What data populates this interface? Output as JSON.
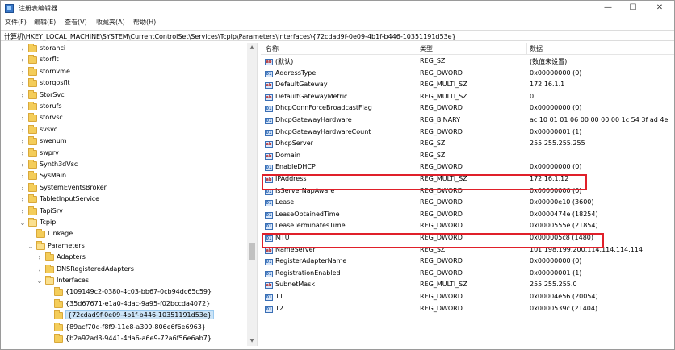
{
  "window": {
    "title": "注册表编辑器"
  },
  "titlebar": {
    "minimize": "—",
    "maximize": "☐",
    "close": "✕"
  },
  "menu": [
    "文件(F)",
    "编辑(E)",
    "查看(V)",
    "收藏夹(A)",
    "帮助(H)"
  ],
  "address": "计算机\\HKEY_LOCAL_MACHINE\\SYSTEM\\CurrentControlSet\\Services\\Tcpip\\Parameters\\Interfaces\\{72cdad9f-0e09-4b1f-b446-10351191d53e}",
  "tree": [
    {
      "label": "storahci",
      "level": 0,
      "expanded": false
    },
    {
      "label": "storflt",
      "level": 0,
      "expanded": false
    },
    {
      "label": "stornvme",
      "level": 0,
      "expanded": false
    },
    {
      "label": "storqosflt",
      "level": 0,
      "expanded": false
    },
    {
      "label": "StorSvc",
      "level": 0,
      "expanded": false
    },
    {
      "label": "storufs",
      "level": 0,
      "expanded": false
    },
    {
      "label": "storvsc",
      "level": 0,
      "expanded": false
    },
    {
      "label": "svsvc",
      "level": 0,
      "expanded": false
    },
    {
      "label": "swenum",
      "level": 0,
      "expanded": false
    },
    {
      "label": "swprv",
      "level": 0,
      "expanded": false
    },
    {
      "label": "Synth3dVsc",
      "level": 0,
      "expanded": false
    },
    {
      "label": "SysMain",
      "level": 0,
      "expanded": false
    },
    {
      "label": "SystemEventsBroker",
      "level": 0,
      "expanded": false
    },
    {
      "label": "TabletInputService",
      "level": 0,
      "expanded": false
    },
    {
      "label": "TapiSrv",
      "level": 0,
      "expanded": false
    },
    {
      "label": "Tcpip",
      "level": 0,
      "expanded": true
    },
    {
      "label": "Linkage",
      "level": 1,
      "expanded": null
    },
    {
      "label": "Parameters",
      "level": 1,
      "expanded": true
    },
    {
      "label": "Adapters",
      "level": 2,
      "expanded": false
    },
    {
      "label": "DNSRegisteredAdapters",
      "level": 2,
      "expanded": false
    },
    {
      "label": "Interfaces",
      "level": 2,
      "expanded": true
    },
    {
      "label": "{109149c2-0380-4c03-bb67-0cb94dc65c59}",
      "level": 3,
      "expanded": null
    },
    {
      "label": "{35d67671-e1a0-4dac-9a95-f02bccda4072}",
      "level": 3,
      "expanded": null
    },
    {
      "label": "{72cdad9f-0e09-4b1f-b446-10351191d53e}",
      "level": 3,
      "expanded": null,
      "selected": true
    },
    {
      "label": "{89acf70d-f8f9-11e8-a309-806e6f6e6963}",
      "level": 3,
      "expanded": null
    },
    {
      "label": "{b2a92ad3-9441-4da6-a6e9-72a6f56e6ab7}",
      "level": 3,
      "expanded": null
    }
  ],
  "columns": {
    "name": "名称",
    "type": "类型",
    "data": "数据"
  },
  "values": [
    {
      "name": "(默认)",
      "type": "REG_SZ",
      "data": "(数值未设置)",
      "icon": "ab"
    },
    {
      "name": "AddressType",
      "type": "REG_DWORD",
      "data": "0x00000000 (0)",
      "icon": "bin"
    },
    {
      "name": "DefaultGateway",
      "type": "REG_MULTI_SZ",
      "data": "172.16.1.1",
      "icon": "ab"
    },
    {
      "name": "DefaultGatewayMetric",
      "type": "REG_MULTI_SZ",
      "data": "0",
      "icon": "ab"
    },
    {
      "name": "DhcpConnForceBroadcastFlag",
      "type": "REG_DWORD",
      "data": "0x00000000 (0)",
      "icon": "bin"
    },
    {
      "name": "DhcpGatewayHardware",
      "type": "REG_BINARY",
      "data": "ac 10 01 01 06 00 00 00 00 1c 54 3f ad 4e",
      "icon": "bin"
    },
    {
      "name": "DhcpGatewayHardwareCount",
      "type": "REG_DWORD",
      "data": "0x00000001 (1)",
      "icon": "bin"
    },
    {
      "name": "DhcpServer",
      "type": "REG_SZ",
      "data": "255.255.255.255",
      "icon": "ab"
    },
    {
      "name": "Domain",
      "type": "REG_SZ",
      "data": "",
      "icon": "ab"
    },
    {
      "name": "EnableDHCP",
      "type": "REG_DWORD",
      "data": "0x00000000 (0)",
      "icon": "bin"
    },
    {
      "name": "IPAddress",
      "type": "REG_MULTI_SZ",
      "data": "172.16.1.12",
      "icon": "ab"
    },
    {
      "name": "IsServerNapAware",
      "type": "REG_DWORD",
      "data": "0x00000000 (0)",
      "icon": "bin"
    },
    {
      "name": "Lease",
      "type": "REG_DWORD",
      "data": "0x00000e10 (3600)",
      "icon": "bin"
    },
    {
      "name": "LeaseObtainedTime",
      "type": "REG_DWORD",
      "data": "0x0000474e (18254)",
      "icon": "bin"
    },
    {
      "name": "LeaseTerminatesTime",
      "type": "REG_DWORD",
      "data": "0x0000555e (21854)",
      "icon": "bin"
    },
    {
      "name": "MTU",
      "type": "REG_DWORD",
      "data": "0x000005c8 (1480)",
      "icon": "bin"
    },
    {
      "name": "NameServer",
      "type": "REG_SZ",
      "data": "101.198.199.200,114.114.114.114",
      "icon": "ab"
    },
    {
      "name": "RegisterAdapterName",
      "type": "REG_DWORD",
      "data": "0x00000000 (0)",
      "icon": "bin"
    },
    {
      "name": "RegistrationEnabled",
      "type": "REG_DWORD",
      "data": "0x00000001 (1)",
      "icon": "bin"
    },
    {
      "name": "SubnetMask",
      "type": "REG_MULTI_SZ",
      "data": "255.255.255.0",
      "icon": "ab"
    },
    {
      "name": "T1",
      "type": "REG_DWORD",
      "data": "0x00004e56 (20054)",
      "icon": "bin"
    },
    {
      "name": "T2",
      "type": "REG_DWORD",
      "data": "0x0000539c (21404)",
      "icon": "bin"
    }
  ],
  "highlight_color": "#e0202a",
  "selected_color": "#cce4f7"
}
